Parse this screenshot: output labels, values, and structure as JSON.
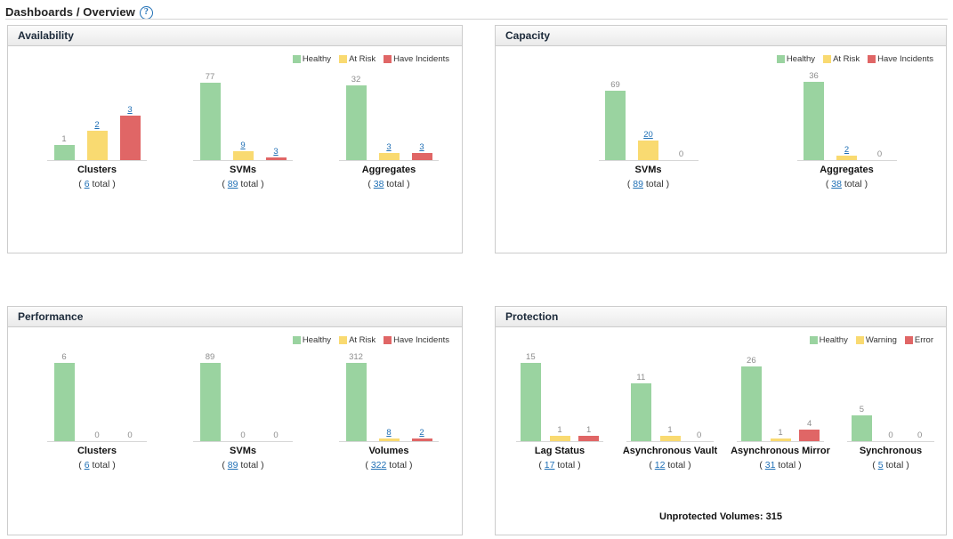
{
  "breadcrumb": {
    "text": "Dashboards / Overview",
    "help_icon": "help-circle-icon",
    "help_glyph": "?"
  },
  "colors": {
    "healthy": "#9ad3a0",
    "at_risk": "#f9da71",
    "have_incidents": "#e06666",
    "link": "#1f6fb5",
    "plain_value": "#8c8c8c",
    "axis": "#d7d7d7",
    "panel_border": "#cccccc",
    "panel_header_bg": "#f0f0f0"
  },
  "panels": [
    {
      "id": "availability",
      "title": "Availability",
      "legend": [
        {
          "label": "Healthy",
          "color": "#9ad3a0"
        },
        {
          "label": "At Risk",
          "color": "#f9da71"
        },
        {
          "label": "Have Incidents",
          "color": "#e06666"
        }
      ],
      "chart_data": {
        "type": "bar",
        "title": "Availability",
        "categories": [
          "Clusters",
          "SVMs",
          "Aggregates"
        ],
        "series": [
          {
            "name": "Healthy",
            "color": "#9ad3a0",
            "values": [
              1,
              77,
              32
            ]
          },
          {
            "name": "At Risk",
            "color": "#f9da71",
            "values": [
              2,
              9,
              3
            ]
          },
          {
            "name": "Have Incidents",
            "color": "#e06666",
            "values": [
              3,
              3,
              3
            ]
          }
        ],
        "totals": [
          6,
          89,
          38
        ],
        "ylim": [
          0,
          77
        ],
        "grid": false,
        "legend_position": "top-right"
      },
      "groups": [
        {
          "label": "Clusters",
          "total_prefix": "( ",
          "total": "6",
          "total_suffix": " total )",
          "bars": [
            {
              "series": "Healthy",
              "value": "1",
              "num": 1,
              "link": false
            },
            {
              "series": "At Risk",
              "value": "2",
              "num": 2,
              "link": true
            },
            {
              "series": "Have Incidents",
              "value": "3",
              "num": 3,
              "link": true
            }
          ],
          "scale_max": 6
        },
        {
          "label": "SVMs",
          "total_prefix": "( ",
          "total": "89",
          "total_suffix": " total )",
          "bars": [
            {
              "series": "Healthy",
              "value": "77",
              "num": 77,
              "link": false
            },
            {
              "series": "At Risk",
              "value": "9",
              "num": 9,
              "link": true
            },
            {
              "series": "Have Incidents",
              "value": "3",
              "num": 3,
              "link": true
            }
          ],
          "scale_max": 89
        },
        {
          "label": "Aggregates",
          "total_prefix": "( ",
          "total": "38",
          "total_suffix": " total )",
          "bars": [
            {
              "series": "Healthy",
              "value": "32",
              "num": 32,
              "link": false
            },
            {
              "series": "At Risk",
              "value": "3",
              "num": 3,
              "link": true
            },
            {
              "series": "Have Incidents",
              "value": "3",
              "num": 3,
              "link": true
            }
          ],
          "scale_max": 38
        }
      ]
    },
    {
      "id": "capacity",
      "title": "Capacity",
      "legend": [
        {
          "label": "Healthy",
          "color": "#9ad3a0"
        },
        {
          "label": "At Risk",
          "color": "#f9da71"
        },
        {
          "label": "Have Incidents",
          "color": "#e06666"
        }
      ],
      "chart_data": {
        "type": "bar",
        "title": "Capacity",
        "categories": [
          "SVMs",
          "Aggregates"
        ],
        "series": [
          {
            "name": "Healthy",
            "color": "#9ad3a0",
            "values": [
              69,
              36
            ]
          },
          {
            "name": "At Risk",
            "color": "#f9da71",
            "values": [
              20,
              2
            ]
          },
          {
            "name": "Have Incidents",
            "color": "#e06666",
            "values": [
              0,
              0
            ]
          }
        ],
        "totals": [
          89,
          38
        ],
        "ylim": [
          0,
          69
        ],
        "grid": false,
        "legend_position": "top-right"
      },
      "groups": [
        {
          "label": "SVMs",
          "total_prefix": "( ",
          "total": "89",
          "total_suffix": " total )",
          "bars": [
            {
              "series": "Healthy",
              "value": "69",
              "num": 69,
              "link": false
            },
            {
              "series": "At Risk",
              "value": "20",
              "num": 20,
              "link": true
            },
            {
              "series": "Have Incidents",
              "value": "0",
              "num": 0,
              "link": false
            }
          ],
          "scale_max": 89
        },
        {
          "label": "Aggregates",
          "total_prefix": "( ",
          "total": "38",
          "total_suffix": " total )",
          "bars": [
            {
              "series": "Healthy",
              "value": "36",
              "num": 36,
              "link": false
            },
            {
              "series": "At Risk",
              "value": "2",
              "num": 2,
              "link": true
            },
            {
              "series": "Have Incidents",
              "value": "0",
              "num": 0,
              "link": false
            }
          ],
          "scale_max": 38
        }
      ]
    },
    {
      "id": "performance",
      "title": "Performance",
      "legend": [
        {
          "label": "Healthy",
          "color": "#9ad3a0"
        },
        {
          "label": "At Risk",
          "color": "#f9da71"
        },
        {
          "label": "Have Incidents",
          "color": "#e06666"
        }
      ],
      "chart_data": {
        "type": "bar",
        "title": "Performance",
        "categories": [
          "Clusters",
          "SVMs",
          "Volumes"
        ],
        "series": [
          {
            "name": "Healthy",
            "color": "#9ad3a0",
            "values": [
              6,
              89,
              312
            ]
          },
          {
            "name": "At Risk",
            "color": "#f9da71",
            "values": [
              0,
              0,
              8
            ]
          },
          {
            "name": "Have Incidents",
            "color": "#e06666",
            "values": [
              0,
              0,
              2
            ]
          }
        ],
        "totals": [
          6,
          89,
          322
        ],
        "ylim": [
          0,
          312
        ],
        "grid": false,
        "legend_position": "top-right"
      },
      "groups": [
        {
          "label": "Clusters",
          "total_prefix": "( ",
          "total": "6",
          "total_suffix": " total )",
          "bars": [
            {
              "series": "Healthy",
              "value": "6",
              "num": 6,
              "link": false
            },
            {
              "series": "At Risk",
              "value": "0",
              "num": 0,
              "link": false
            },
            {
              "series": "Have Incidents",
              "value": "0",
              "num": 0,
              "link": false
            }
          ],
          "scale_max": 6
        },
        {
          "label": "SVMs",
          "total_prefix": "( ",
          "total": "89",
          "total_suffix": " total )",
          "bars": [
            {
              "series": "Healthy",
              "value": "89",
              "num": 89,
              "link": false
            },
            {
              "series": "At Risk",
              "value": "0",
              "num": 0,
              "link": false
            },
            {
              "series": "Have Incidents",
              "value": "0",
              "num": 0,
              "link": false
            }
          ],
          "scale_max": 89
        },
        {
          "label": "Volumes",
          "total_prefix": "( ",
          "total": "322",
          "total_suffix": " total )",
          "bars": [
            {
              "series": "Healthy",
              "value": "312",
              "num": 312,
              "link": false
            },
            {
              "series": "At Risk",
              "value": "8",
              "num": 8,
              "link": true
            },
            {
              "series": "Have Incidents",
              "value": "2",
              "num": 2,
              "link": true
            }
          ],
          "scale_max": 322
        }
      ]
    },
    {
      "id": "protection",
      "title": "Protection",
      "legend": [
        {
          "label": "Healthy",
          "color": "#9ad3a0"
        },
        {
          "label": "Warning",
          "color": "#f9da71"
        },
        {
          "label": "Error",
          "color": "#e06666"
        }
      ],
      "footnote": "Unprotected Volumes: 315",
      "chart_data": {
        "type": "bar",
        "title": "Protection",
        "categories": [
          "Lag Status",
          "Asynchronous Vault",
          "Asynchronous Mirror",
          "Synchronous"
        ],
        "series": [
          {
            "name": "Healthy",
            "color": "#9ad3a0",
            "values": [
              15,
              11,
              26,
              5
            ]
          },
          {
            "name": "Warning",
            "color": "#f9da71",
            "values": [
              1,
              1,
              1,
              0
            ]
          },
          {
            "name": "Error",
            "color": "#e06666",
            "values": [
              1,
              0,
              4,
              0
            ]
          }
        ],
        "totals": [
          17,
          12,
          31,
          5
        ],
        "unprotected_volumes": 315,
        "ylim": [
          0,
          26
        ],
        "grid": false,
        "legend_position": "top-right"
      },
      "groups": [
        {
          "label": "Lag Status",
          "total_prefix": "( ",
          "total": "17",
          "total_suffix": " total )",
          "bars": [
            {
              "series": "Healthy",
              "value": "15",
              "num": 15,
              "link": false
            },
            {
              "series": "Warning",
              "value": "1",
              "num": 1,
              "link": false
            },
            {
              "series": "Error",
              "value": "1",
              "num": 1,
              "link": false
            }
          ],
          "scale_max": 17
        },
        {
          "label": "Asynchronous Vault",
          "total_prefix": "( ",
          "total": "12",
          "total_suffix": " total )",
          "bars": [
            {
              "series": "Healthy",
              "value": "11",
              "num": 11,
              "link": false
            },
            {
              "series": "Warning",
              "value": "1",
              "num": 1,
              "link": false
            },
            {
              "series": "Error",
              "value": "0",
              "num": 0,
              "link": false
            }
          ],
          "scale_max": 17
        },
        {
          "label": "Asynchronous Mirror",
          "total_prefix": "( ",
          "total": "31",
          "total_suffix": " total )",
          "bars": [
            {
              "series": "Healthy",
              "value": "26",
              "num": 26,
              "link": false
            },
            {
              "series": "Warning",
              "value": "1",
              "num": 1,
              "link": false
            },
            {
              "series": "Error",
              "value": "4",
              "num": 4,
              "link": false
            }
          ],
          "scale_max": 31
        },
        {
          "label": "Synchronous",
          "total_prefix": "( ",
          "total": "5",
          "total_suffix": " total )",
          "bars": [
            {
              "series": "Healthy",
              "value": "5",
              "num": 5,
              "link": false
            },
            {
              "series": "Warning",
              "value": "0",
              "num": 0,
              "link": false
            },
            {
              "series": "Error",
              "value": "0",
              "num": 0,
              "link": false
            }
          ],
          "scale_max": 17
        }
      ]
    }
  ]
}
